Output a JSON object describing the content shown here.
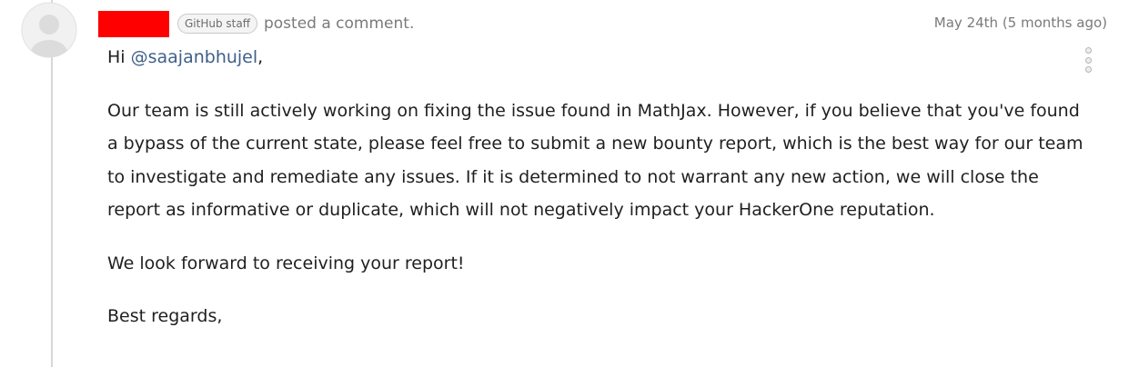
{
  "comment": {
    "badge": "GitHub staff",
    "action": "posted a comment.",
    "timestamp": "May 24th (5 months ago)",
    "greeting_prefix": "Hi ",
    "mention": "@saajanbhujel",
    "greeting_suffix": ",",
    "paragraph_main": "Our team is still actively working on fixing the issue found in MathJax. However, if you believe that you've found a bypass of the current state, please feel free to submit a new bounty report, which is the best way for our team to investigate and remediate any issues. If it is determined to not warrant any new action, we will close the report as informative or duplicate, which will not negatively impact your HackerOne reputation.",
    "paragraph_forward": "We look forward to receiving your report!",
    "closing": "Best regards,"
  },
  "colors": {
    "redaction": "#ff0000",
    "mention": "#3f5f8a",
    "muted_text": "#7a7a7a",
    "timeline": "#d7d7d7"
  },
  "icons": {
    "avatar": "default-user-avatar-icon",
    "menu": "vertical-dots-menu-icon"
  }
}
